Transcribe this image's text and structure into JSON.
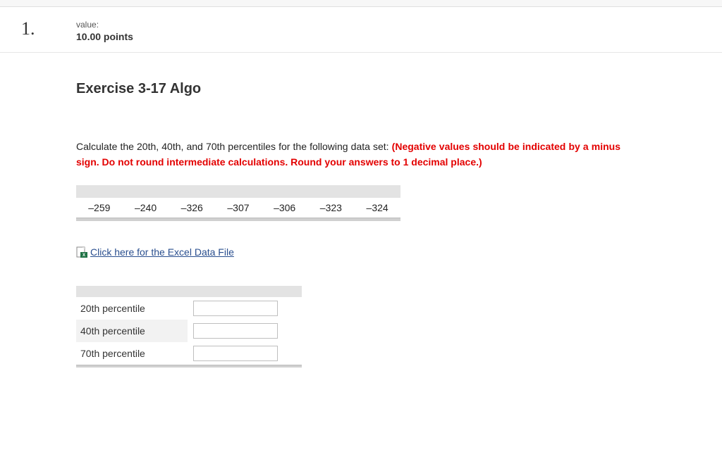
{
  "question": {
    "number": "1.",
    "value_label": "value:",
    "points": "10.00 points"
  },
  "exercise": {
    "title": "Exercise 3-17 Algo",
    "prompt_main": "Calculate the 20th, 40th, and 70th percentiles for the following data set: ",
    "prompt_note": "(Negative values should be indicated by a minus sign. Do not round intermediate calculations. Round your answers to 1 decimal place.)"
  },
  "data_values": [
    "–259",
    "–240",
    "–326",
    "–307",
    "–306",
    "–323",
    "–324"
  ],
  "file_link": {
    "text": " Click here for the Excel Data File",
    "icon": "excel-icon"
  },
  "answers": [
    {
      "label": "20th percentile",
      "value": ""
    },
    {
      "label": "40th percentile",
      "value": ""
    },
    {
      "label": "70th percentile",
      "value": ""
    }
  ]
}
